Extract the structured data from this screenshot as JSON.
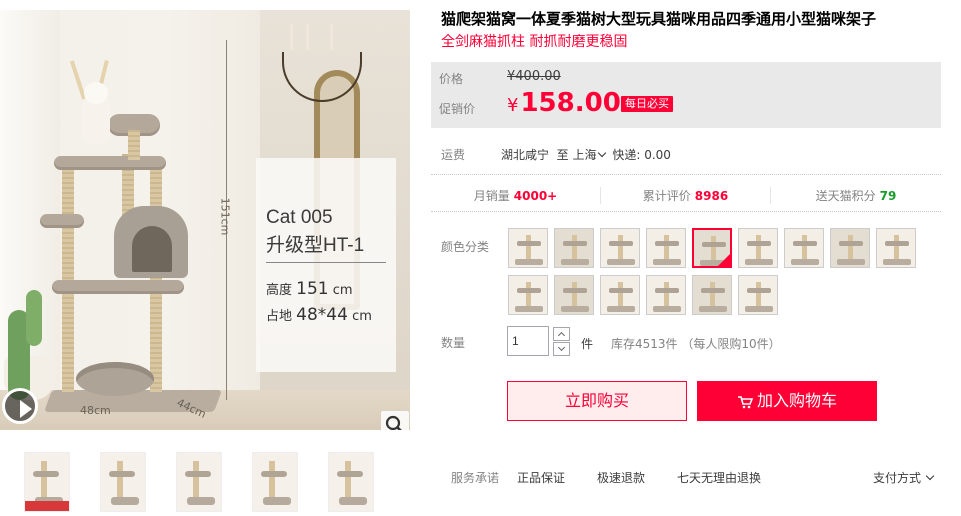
{
  "product": {
    "title": "猫爬架猫窝一体夏季猫树大型玩具猫咪用品四季通用小型猫咪架子",
    "subtitle": "全剑麻猫抓柱 耐抓耐磨更稳固"
  },
  "image": {
    "model": "Cat 005",
    "version": "升级型HT-1",
    "height_label": "高度",
    "height_value": "151",
    "height_unit": "cm",
    "size_label": "占地",
    "size_value": "48*44",
    "size_unit": "cm",
    "dim_height": "151cm",
    "dim_width": "48cm",
    "dim_depth": "44cm"
  },
  "price": {
    "orig_label": "价格",
    "orig_value": "¥400.00",
    "promo_label": "促销价",
    "currency": "¥",
    "promo_value": "158.00",
    "badge": "每日必买"
  },
  "shipping": {
    "label": "运费",
    "from": "湖北咸宁",
    "to_prefix": "至",
    "to": "上海",
    "express": "快递: 0.00"
  },
  "stats": [
    {
      "label": "月销量",
      "value": "4000+",
      "color": "#ff0036"
    },
    {
      "label": "累计评价",
      "value": "8986",
      "color": "#ff0036"
    },
    {
      "label": "送天猫积分",
      "value": "79",
      "color": "#1a9c2c"
    }
  ],
  "color": {
    "label": "颜色分类",
    "selected_index": 4,
    "count": 15
  },
  "quantity": {
    "label": "数量",
    "value": "1",
    "unit": "件",
    "stock": "库存4513件 （每人限购10件）"
  },
  "actions": {
    "buy": "立即购买",
    "cart": "加入购物车"
  },
  "service": {
    "label": "服务承诺",
    "items": [
      "正品保证",
      "极速退款",
      "七天无理由退换"
    ],
    "payment": "支付方式"
  }
}
